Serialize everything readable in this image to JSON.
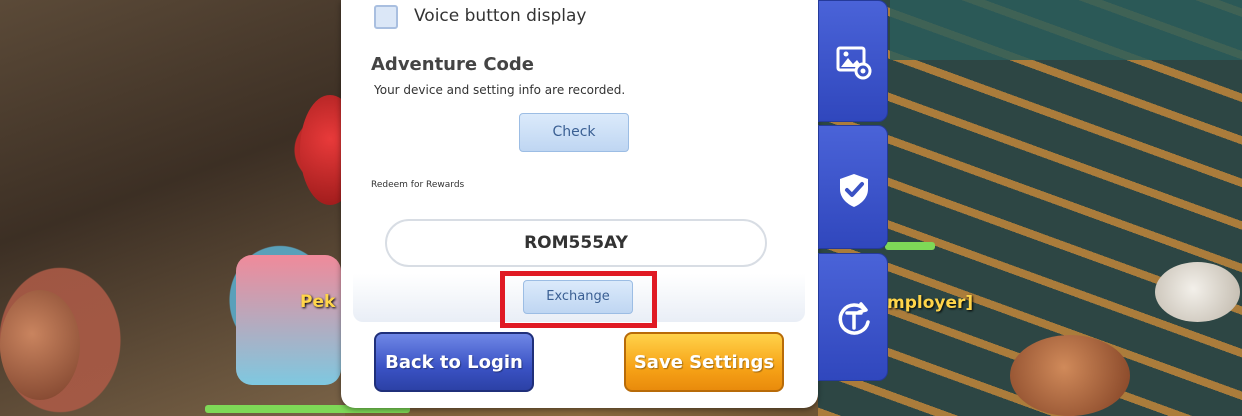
{
  "game_scene": {
    "pet_label": "Pek",
    "npc_label": "mployer]"
  },
  "settings": {
    "voice_button_label": "Voice button display",
    "voice_button_checked": false,
    "adventure_code": {
      "title": "Adventure Code",
      "description": "Your device and setting info are recorded.",
      "check_label": "Check"
    },
    "redeem": {
      "label": "Redeem for Rewards",
      "code_value": "ROM555AY",
      "exchange_label": "Exchange"
    },
    "back_label": "Back to Login",
    "save_label": "Save Settings"
  },
  "side_tabs": [
    {
      "icon": "image-settings-icon"
    },
    {
      "icon": "shield-check-icon"
    },
    {
      "icon": "refresh-t-icon"
    }
  ],
  "colors": {
    "highlight": "#e01a24",
    "primary_blue": "#3a52c4",
    "save_orange": "#f7a317"
  }
}
